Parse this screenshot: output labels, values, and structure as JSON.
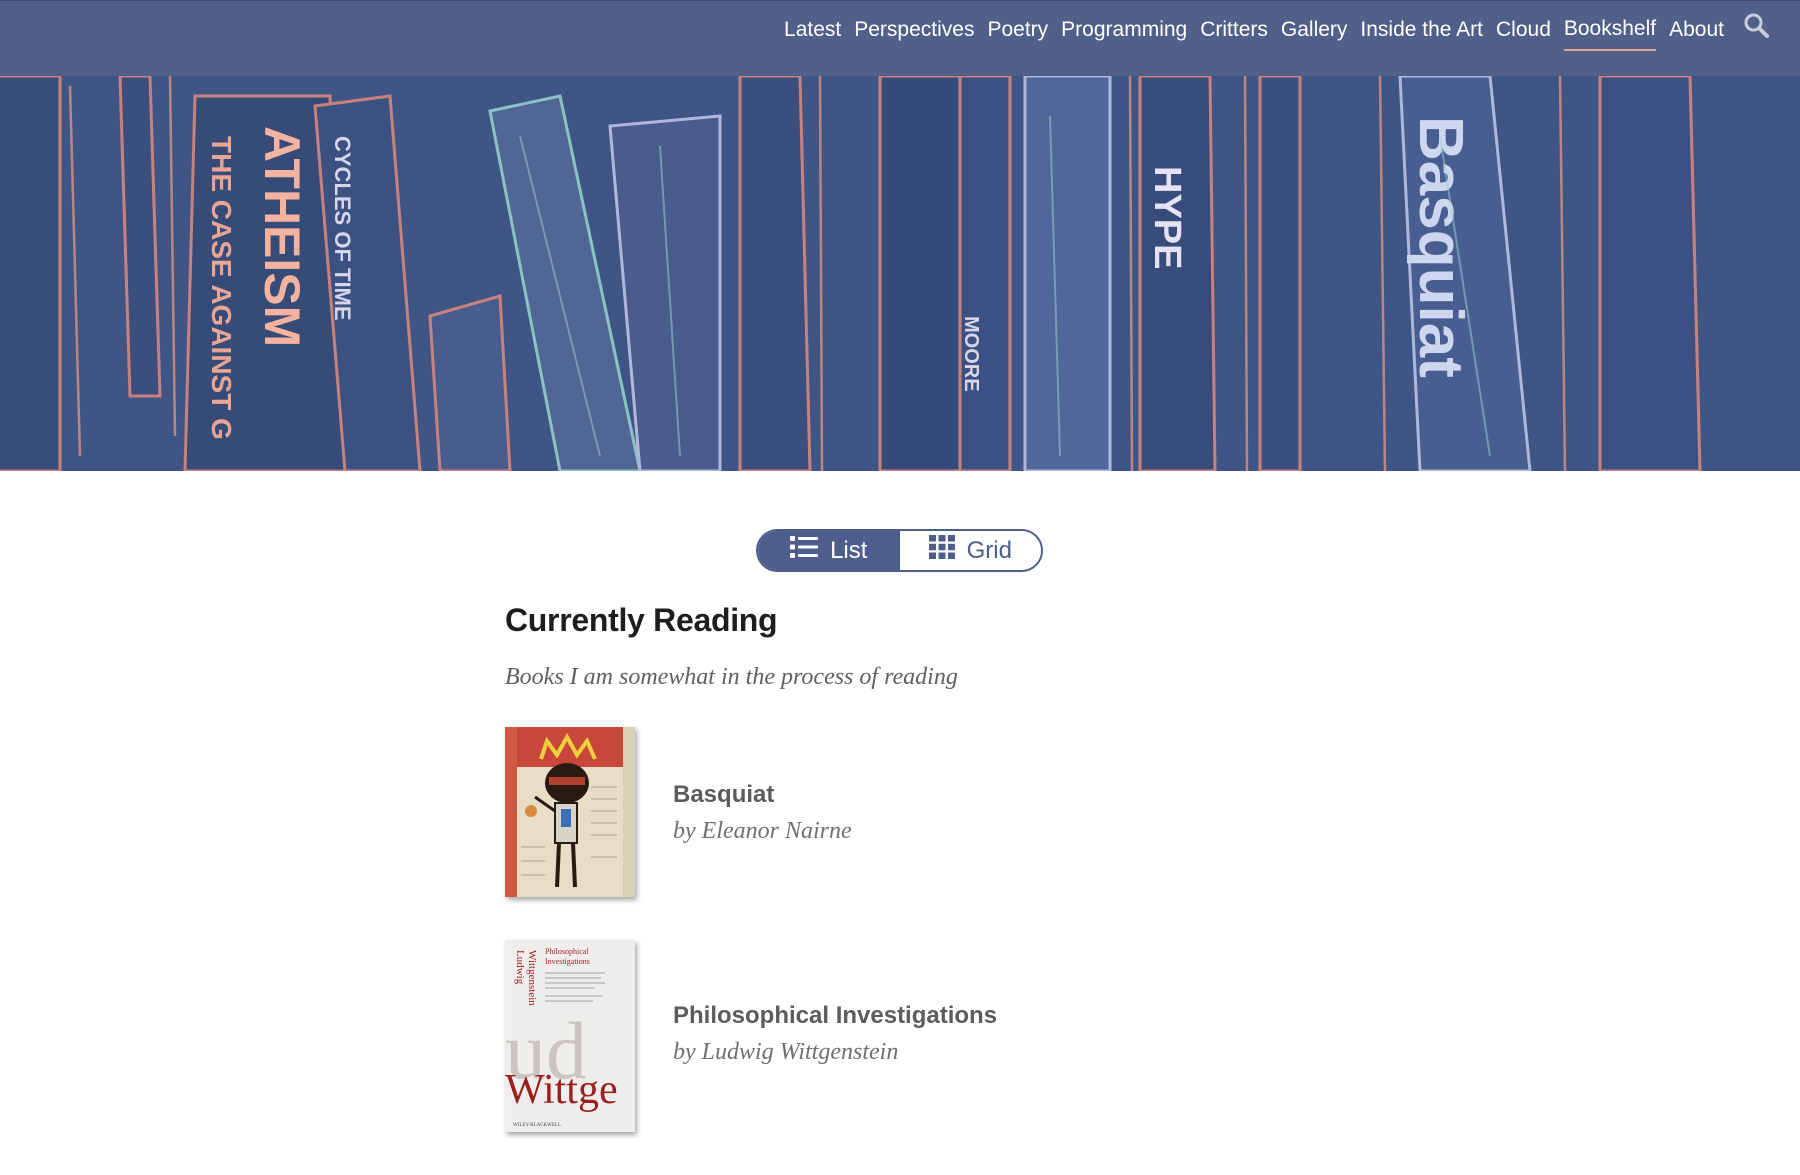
{
  "nav": {
    "items": [
      {
        "label": "Latest"
      },
      {
        "label": "Perspectives"
      },
      {
        "label": "Poetry"
      },
      {
        "label": "Programming"
      },
      {
        "label": "Critters"
      },
      {
        "label": "Gallery"
      },
      {
        "label": "Inside the Art"
      },
      {
        "label": "Cloud"
      },
      {
        "label": "Bookshelf",
        "active": true
      },
      {
        "label": "About"
      }
    ],
    "search_icon": "search-icon"
  },
  "hero": {
    "spine_texts": [
      "ATHEISM",
      "THE CASE AGAINST G",
      "CYCLES OF TIME",
      "HYPE",
      "Basquiat",
      "MOORE"
    ]
  },
  "view_toggle": {
    "list_label": "List",
    "grid_label": "Grid",
    "selected": "List",
    "list_icon": "list-icon",
    "grid_icon": "grid-icon"
  },
  "section": {
    "title": "Currently Reading",
    "subtitle": "Books I am somewhat in the process of reading"
  },
  "books": [
    {
      "title": "Basquiat",
      "author": "by Eleanor Nairne"
    },
    {
      "title": "Philosophical Investigations",
      "author": "by Ludwig Wittgenstein",
      "cover": {
        "side_text_1": "Ludwig",
        "side_text_2": "Wittgenstein",
        "heading_1": "Philosophical",
        "heading_2": "Investigations",
        "big_text": "Wittge",
        "ghost_text": "ud",
        "publisher": "WILEY-BLACKWELL"
      }
    }
  ],
  "colors": {
    "nav_bg": "#506089",
    "accent": "#4e5e8c",
    "active_underline": "#e3a48f"
  }
}
